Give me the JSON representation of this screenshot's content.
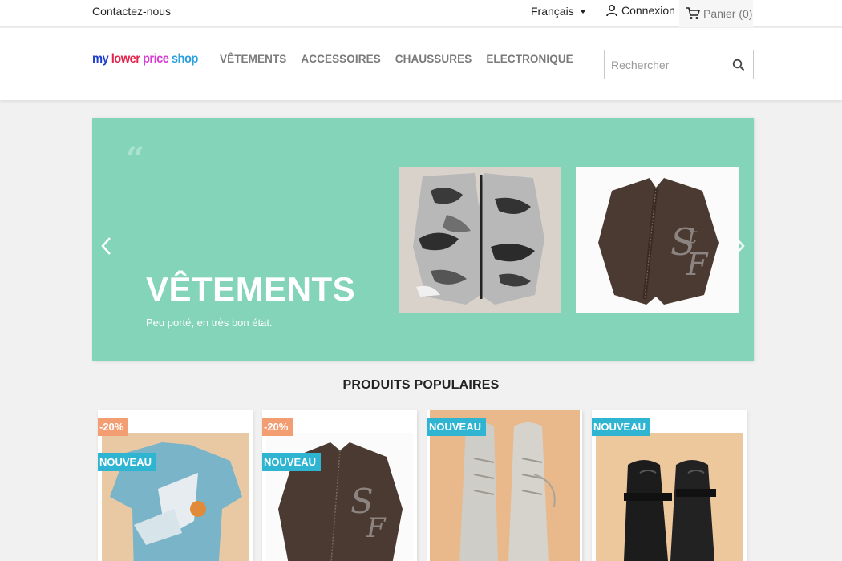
{
  "topbar": {
    "contact": "Contactez-nous",
    "language": "Français",
    "login": "Connexion",
    "cart": "Panier (0)"
  },
  "header": {
    "logo_parts": [
      "my ",
      "lower ",
      "price ",
      "shop"
    ],
    "nav": [
      "VÊTEMENTS",
      "ACCESSOIRES",
      "CHAUSSURES",
      "ELECTRONIQUE"
    ],
    "search_placeholder": "Rechercher"
  },
  "banner": {
    "title": "VÊTEMENTS",
    "subtitle": "Peu porté, en très bon état.",
    "background_color": "#84d4b9"
  },
  "popular": {
    "title": "PRODUITS POPULAIRES",
    "products": [
      {
        "discount": "-20%",
        "flag": "NOUVEAU",
        "image": "blue-tshirt"
      },
      {
        "discount": "-20%",
        "flag": "NOUVEAU",
        "image": "brown-jacket"
      },
      {
        "flag": "NOUVEAU",
        "image": "grey-sneakers"
      },
      {
        "flag": "NOUVEAU",
        "image": "black-shoes"
      }
    ]
  },
  "colors": {
    "discount_badge": "#f39d72",
    "new_badge": "#2fb5d2",
    "nav_text": "#7a7a7a"
  }
}
